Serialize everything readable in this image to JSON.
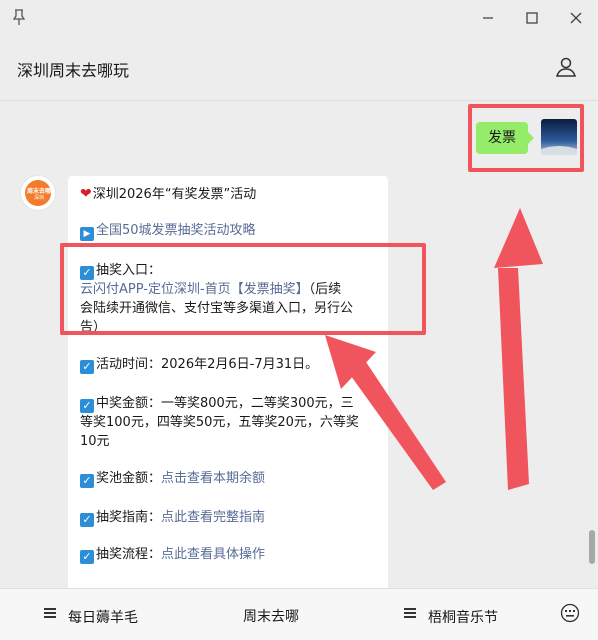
{
  "header": {
    "title": "深圳周末去哪玩"
  },
  "chat": {
    "outgoing": {
      "text": "发票"
    },
    "bot_avatar": {
      "line1": "周末去哪",
      "line2": "深圳"
    },
    "article": {
      "title": "深圳2026年“有奖发票”活动",
      "guide_link": "全国50城发票抽奖活动攻略",
      "entry_label": "抽奖入口：",
      "entry_link": "云闪付APP-定位深圳-首页【发票抽奖】",
      "entry_note_1": "（后续",
      "entry_note_2": "会陆续开通微信、支付宝等多渠道入口，另行公",
      "entry_note_3": "告）",
      "time": "活动时间：2026年2月6日-7月31日。",
      "prize_1": "中奖金额：一等奖800元，二等奖300元，三",
      "prize_2": "等奖100元，四等奖50元，五等奖20元，六等奖",
      "prize_3": "10元",
      "pool_label": "奖池金额：",
      "pool_link": "点击查看本期余额",
      "guide2_label": "抽奖指南：",
      "guide2_link": "点此查看完整指南",
      "process_label": "抽奖流程：",
      "process_link": "点此查看具体操作"
    }
  },
  "bottom_menu": {
    "item1": "每日薅羊毛",
    "item2": "周末去哪",
    "item3": "梧桐音乐节"
  },
  "colors": {
    "accent_red": "#f0545c",
    "bubble_green": "#95ec69",
    "link_blue": "#576b95",
    "check_blue": "#2c8ed6"
  },
  "icons": [
    "pin-icon",
    "minimize-icon",
    "maximize-icon",
    "close-icon",
    "user-icon",
    "checkbox-icon",
    "play-icon",
    "heart-icon",
    "menu-icon",
    "keyboard-icon"
  ]
}
